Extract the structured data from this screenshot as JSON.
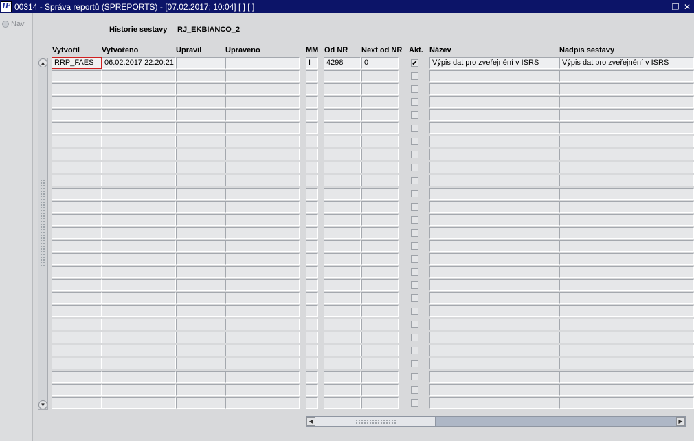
{
  "window": {
    "title": "00314 - Správa reportů (SPREPORTS) - [07.02.2017; 10:04]  [ ]  [ ]",
    "icon_text": "IF"
  },
  "nav": {
    "label": "Nav"
  },
  "header": {
    "history_label": "Historie sestavy",
    "history_value": "RJ_EKBIANCO_2"
  },
  "columns": [
    {
      "key": "vytvoril",
      "label": "Vytvořil"
    },
    {
      "key": "vytvoreno",
      "label": "Vytvořeno"
    },
    {
      "key": "upravil",
      "label": "Upravil"
    },
    {
      "key": "upraveno",
      "label": "Upraveno"
    },
    {
      "key": "mm",
      "label": "MM"
    },
    {
      "key": "od_nr",
      "label": "Od NR"
    },
    {
      "key": "next_od_nr",
      "label": "Next od NR"
    },
    {
      "key": "akt",
      "label": "Akt."
    },
    {
      "key": "nazev",
      "label": "Název"
    },
    {
      "key": "nadpis",
      "label": "Nadpis sestavy"
    }
  ],
  "rows": [
    {
      "vytvoril": "RRP_FAES",
      "vytvoreno": "06.02.2017 22:20:21",
      "upravil": "",
      "upraveno": "",
      "mm": "I",
      "od_nr": "4298",
      "next_od_nr": "0",
      "akt": true,
      "nazev": "Výpis dat pro zveřejnění v ISRS",
      "nadpis": "Výpis dat pro zveřejnění v ISRS"
    }
  ],
  "empty_row_count": 26,
  "check_mark": "✔",
  "icons": {
    "restore": "restore-icon",
    "close": "close-icon",
    "scroll_up": "arrow-up-icon",
    "scroll_down": "arrow-down-icon",
    "scroll_left": "arrow-left-icon",
    "scroll_right": "arrow-right-icon"
  }
}
